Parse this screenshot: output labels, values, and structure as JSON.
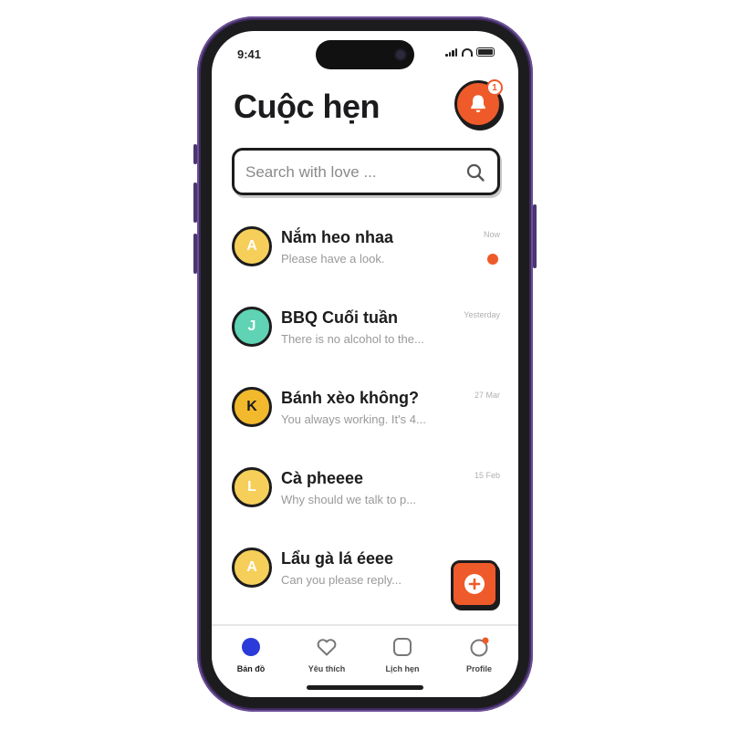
{
  "status_bar": {
    "time": "9:41"
  },
  "header": {
    "title": "Cuộc hẹn",
    "notification_count": "1"
  },
  "search": {
    "placeholder": "Search with love ..."
  },
  "chats": [
    {
      "avatar_letter": "A",
      "avatar_color": "#f6cf5a",
      "name": "Nắm heo nhaa",
      "preview": "Please have a look.",
      "time": "Now",
      "unread": true
    },
    {
      "avatar_letter": "J",
      "avatar_color": "#5fd3b3",
      "name": "BBQ Cuối tuần",
      "preview": "There is no alcohol to the...",
      "time": "Yesterday",
      "unread": false
    },
    {
      "avatar_letter": "K",
      "avatar_color": "#f2b92c",
      "name": "Bánh xèo không?",
      "preview": "You always working. It's 4...",
      "time": "27 Mar",
      "unread": false
    },
    {
      "avatar_letter": "L",
      "avatar_color": "#f6cf5a",
      "name": "Cà pheeee",
      "preview": "Why should we talk to p...",
      "time": "15 Feb",
      "unread": false
    },
    {
      "avatar_letter": "A",
      "avatar_color": "#f6cf5a",
      "name": "Lẩu gà lá éeee",
      "preview": "Can you please reply...",
      "time": "",
      "unread": false
    }
  ],
  "tabs": [
    {
      "label": "Bản đồ",
      "icon": "map-dot-icon",
      "active": true
    },
    {
      "label": "Yêu thích",
      "icon": "heart-icon",
      "active": false
    },
    {
      "label": "Lịch hẹn",
      "icon": "calendar-icon",
      "active": false
    },
    {
      "label": "Profile",
      "icon": "profile-icon",
      "active": false,
      "badge": true
    }
  ],
  "colors": {
    "accent": "#ef5a2a",
    "active_tab": "#2a3bd9",
    "frame": "#3d2a5c",
    "ink": "#1c1c1e"
  }
}
